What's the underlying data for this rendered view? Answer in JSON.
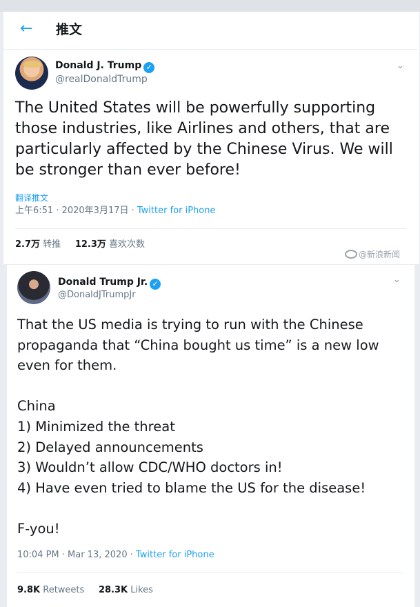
{
  "header": {
    "back_icon": "back-arrow-icon",
    "title": "推文"
  },
  "tweet1": {
    "name": "Donald J. Trump",
    "handle": "@realDonaldTrump",
    "text": "The United States will be powerfully supporting those industries, like Airlines and others, that are particularly affected by the Chinese Virus. We will be stronger than ever before!",
    "translate_label": "翻译推文",
    "time": "上午6:51 · 2020年3月17日 · ",
    "source": "Twitter for iPhone",
    "retweets_count": "2.7万",
    "retweets_label": " 转推",
    "likes_count": "12.3万",
    "likes_label": " 喜欢次数"
  },
  "watermark": {
    "text": "@新浪新闻"
  },
  "tweet2": {
    "name": "Donald Trump Jr.",
    "handle": "@DonaldJTrumpJr",
    "lines": [
      "That the US media is trying to run with the Chinese propaganda that “China bought us time” is a new low even for them.",
      "",
      "China",
      "1) Minimized the threat",
      "2) Delayed announcements",
      "3) Wouldn’t allow CDC/WHO doctors in!",
      "4) Have even tried to blame the US for the disease!",
      "",
      "F-you!"
    ],
    "time": "10:04 PM · Mar 13, 2020 · ",
    "source": "Twitter for iPhone",
    "retweets_count": "9.8K",
    "retweets_label": " Retweets",
    "likes_count": "28.3K",
    "likes_label": " Likes"
  },
  "colors": {
    "accent": "#1da1f2",
    "muted": "#657786"
  }
}
